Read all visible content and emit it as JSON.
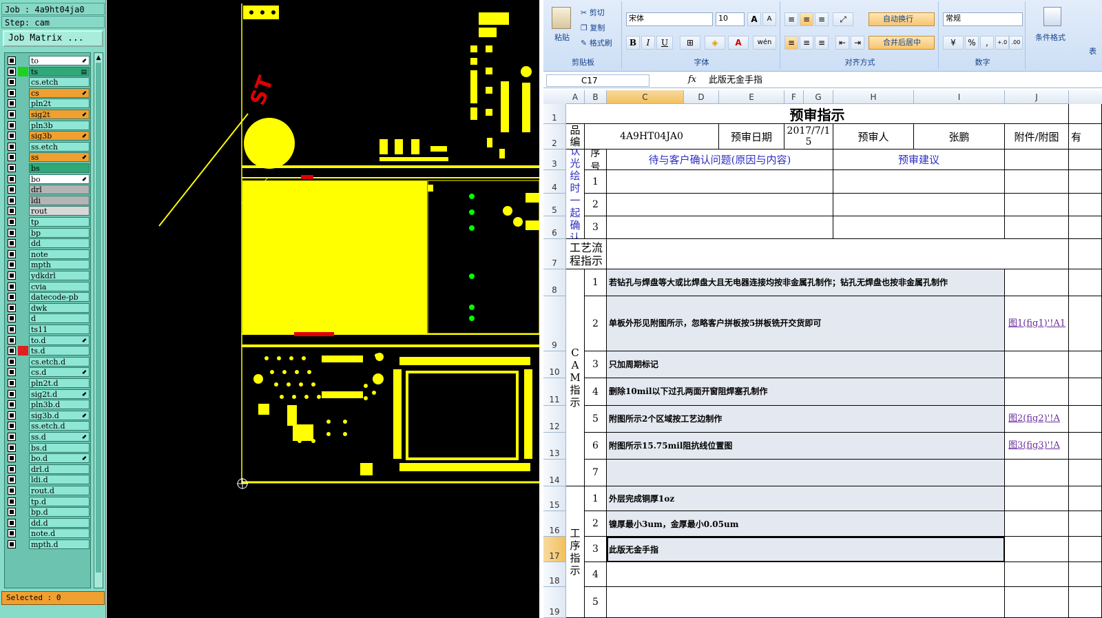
{
  "cam": {
    "job_line": "Job : 4a9ht04ja0",
    "step_line": "Step: cam",
    "matrix_button": "Job Matrix ...",
    "selected": "Selected : 0",
    "scroll_up": "▲",
    "layers": [
      {
        "name": "to",
        "color": "#ffffff",
        "arrow": "⬋"
      },
      {
        "name": "ts",
        "color": "#30a878",
        "arrow": "▤"
      },
      {
        "name": "cs.etch",
        "color": "#8ee6d4",
        "arrow": ""
      },
      {
        "name": "cs",
        "color": "#f0a030",
        "arrow": "⬋"
      },
      {
        "name": "pln2t",
        "color": "#8ee6d4",
        "arrow": ""
      },
      {
        "name": "sig2t",
        "color": "#f0a030",
        "arrow": "⬋"
      },
      {
        "name": "pln3b",
        "color": "#8ee6d4",
        "arrow": ""
      },
      {
        "name": "sig3b",
        "color": "#f0a030",
        "arrow": "⬋"
      },
      {
        "name": "ss.etch",
        "color": "#8ee6d4",
        "arrow": ""
      },
      {
        "name": "ss",
        "color": "#f0a030",
        "arrow": "⬋"
      },
      {
        "name": "bs",
        "color": "#30a878",
        "arrow": ""
      },
      {
        "name": "bo",
        "color": "#ffffff",
        "arrow": "⬋"
      },
      {
        "name": "drl",
        "color": "#b4b4b4",
        "arrow": ""
      },
      {
        "name": "ldi",
        "color": "#b4b4b4",
        "arrow": ""
      },
      {
        "name": "rout",
        "color": "#d8d8d8",
        "arrow": ""
      },
      {
        "name": "tp",
        "color": "#8ee6d4",
        "arrow": ""
      },
      {
        "name": "bp",
        "color": "#8ee6d4",
        "arrow": ""
      },
      {
        "name": "dd",
        "color": "#8ee6d4",
        "arrow": ""
      },
      {
        "name": "note",
        "color": "#8ee6d4",
        "arrow": ""
      },
      {
        "name": "mpth",
        "color": "#8ee6d4",
        "arrow": ""
      },
      {
        "name": "ydkdrl",
        "color": "#8ee6d4",
        "arrow": ""
      },
      {
        "name": "cvia",
        "color": "#8ee6d4",
        "arrow": ""
      },
      {
        "name": "datecode-pb",
        "color": "#8ee6d4",
        "arrow": ""
      },
      {
        "name": "dwk",
        "color": "#8ee6d4",
        "arrow": ""
      },
      {
        "name": "d",
        "color": "#8ee6d4",
        "arrow": ""
      },
      {
        "name": "ts11",
        "color": "#8ee6d4",
        "arrow": ""
      },
      {
        "name": "to.d",
        "color": "#8ee6d4",
        "arrow": "⬋"
      },
      {
        "name": "ts.d",
        "color": "#8ee6d4",
        "arrow": ""
      },
      {
        "name": "cs.etch.d",
        "color": "#8ee6d4",
        "arrow": ""
      },
      {
        "name": "cs.d",
        "color": "#8ee6d4",
        "arrow": "⬋"
      },
      {
        "name": "pln2t.d",
        "color": "#8ee6d4",
        "arrow": ""
      },
      {
        "name": "sig2t.d",
        "color": "#8ee6d4",
        "arrow": "⬋"
      },
      {
        "name": "pln3b.d",
        "color": "#8ee6d4",
        "arrow": ""
      },
      {
        "name": "sig3b.d",
        "color": "#8ee6d4",
        "arrow": "⬋"
      },
      {
        "name": "ss.etch.d",
        "color": "#8ee6d4",
        "arrow": ""
      },
      {
        "name": "ss.d",
        "color": "#8ee6d4",
        "arrow": "⬋"
      },
      {
        "name": "bs.d",
        "color": "#8ee6d4",
        "arrow": ""
      },
      {
        "name": "bo.d",
        "color": "#8ee6d4",
        "arrow": "⬋"
      },
      {
        "name": "drl.d",
        "color": "#8ee6d4",
        "arrow": ""
      },
      {
        "name": "ldi.d",
        "color": "#8ee6d4",
        "arrow": ""
      },
      {
        "name": "rout.d",
        "color": "#8ee6d4",
        "arrow": ""
      },
      {
        "name": "tp.d",
        "color": "#8ee6d4",
        "arrow": ""
      },
      {
        "name": "bp.d",
        "color": "#8ee6d4",
        "arrow": ""
      },
      {
        "name": "dd.d",
        "color": "#8ee6d4",
        "arrow": ""
      },
      {
        "name": "note.d",
        "color": "#8ee6d4",
        "arrow": ""
      },
      {
        "name": "mpth.d",
        "color": "#8ee6d4",
        "arrow": ""
      }
    ],
    "layer_swatches": {
      "ts": "#20d020",
      "ts.d": "#e02020"
    }
  },
  "excel": {
    "ribbon": {
      "paste": "粘贴",
      "cut": "剪切",
      "copy": "复制",
      "format_painter": "格式刷",
      "clipboard_group": "剪贴板",
      "font_name": "宋体",
      "font_size": "10",
      "font_group": "字体",
      "bold": "B",
      "italic": "I",
      "underline": "U",
      "font_color": "A",
      "grow_font": "A",
      "shrink_font": "A",
      "wen": "wén",
      "wrap_text": "自动换行",
      "merge_center": "合并后居中",
      "align_group": "对齐方式",
      "number_format": "常规",
      "percent": "%",
      "comma": ",",
      "inc_decimal": "+.0",
      "dec_decimal": ".00",
      "number_group": "数字",
      "cond_format": "条件格式",
      "more": "表"
    },
    "name_box": "C17",
    "fx": "fx",
    "formula": "此版无金手指",
    "columns": [
      "A",
      "B",
      "C",
      "D",
      "E",
      "F",
      "G",
      "H",
      "I",
      "J"
    ],
    "rows": [
      "1",
      "2",
      "3",
      "4",
      "5",
      "6",
      "7",
      "8",
      "9",
      "10",
      "11",
      "12",
      "13",
      "14",
      "15",
      "16",
      "17",
      "18",
      "19"
    ],
    "sheet": {
      "title": "预审指示",
      "product_no_label": "产品编号",
      "product_no": "4A9HT04JA0",
      "date_label": "预审日期",
      "date": "2017/7/15",
      "reviewer_label": "预审人",
      "reviewer": "张鹏",
      "attach_label": "附件/附图",
      "extra": "有",
      "seq_label": "序号",
      "issue_header": "待与客户确认问题(原因与内容)",
      "advice_header": "预审建议",
      "pending_label": "待确认光绘时一起确认问题",
      "pending_nums": [
        "1",
        "2",
        "3"
      ],
      "process_label": "工艺流程指示",
      "cam_label": "CAM指示",
      "cam_items": [
        {
          "n": "1",
          "text": "若钻孔与焊盘等大或比焊盘大且无电器连接均按非金属孔制作；钻孔无焊盘也按非金属孔制作",
          "link": ""
        },
        {
          "n": "2",
          "text": "单板外形见附图所示，忽略客户拼板按5拼板铣开交货即可",
          "link": "图1(fig1)'!A1"
        },
        {
          "n": "3",
          "text": "只加周期标记",
          "link": ""
        },
        {
          "n": "4",
          "text": "删除10mil以下过孔两面开窗阻焊塞孔制作",
          "link": ""
        },
        {
          "n": "5",
          "text": "附图所示2个区域按工艺边制作",
          "link": "图2(fig2)'!A"
        },
        {
          "n": "6",
          "text": "附图所示15.75mil阻抗线位置图",
          "link": "图3(fig3)'!A"
        },
        {
          "n": "7",
          "text": "",
          "link": ""
        }
      ],
      "proc_label": "工序指示",
      "proc_items": [
        {
          "n": "1",
          "text": "外层完成铜厚1oz"
        },
        {
          "n": "2",
          "text": "镍厚最小3um，金厚最小0.05um"
        },
        {
          "n": "3",
          "text": "此版无金手指"
        },
        {
          "n": "4",
          "text": ""
        },
        {
          "n": "5",
          "text": ""
        }
      ]
    }
  }
}
